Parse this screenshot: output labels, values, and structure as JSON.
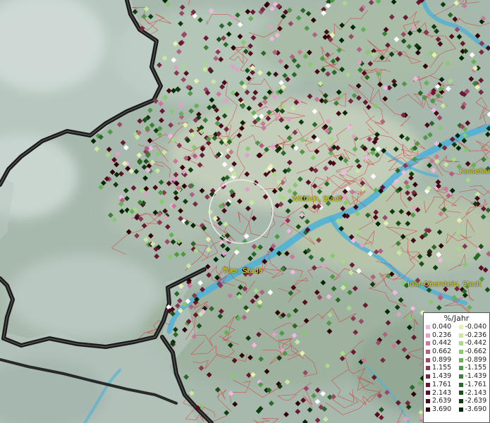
{
  "map": {
    "cities": [
      {
        "name": "Wittlich, Stadt"
      },
      {
        "name": "Trier, Stadt"
      },
      {
        "name": "Idar-Oberstein, Stadt"
      },
      {
        "name": "Kastellaun"
      }
    ]
  },
  "legend": {
    "title": "%/Jahr",
    "positive": [
      {
        "label": "0.040",
        "color": "#f0b8e0"
      },
      {
        "label": "0.236",
        "color": "#e0a0c8"
      },
      {
        "label": "0.442",
        "color": "#c87898"
      },
      {
        "label": "0.662",
        "color": "#b06080"
      },
      {
        "label": "0.899",
        "color": "#9a4868"
      },
      {
        "label": "1.155",
        "color": "#883850"
      },
      {
        "label": "1.439",
        "color": "#782840"
      },
      {
        "label": "1.761",
        "color": "#681830"
      },
      {
        "label": "2.143",
        "color": "#580c20"
      },
      {
        "label": "2.639",
        "color": "#480818"
      },
      {
        "label": "3.690",
        "color": "#300000"
      }
    ],
    "negative": [
      {
        "label": "-0.040",
        "color": "#e8f0b0"
      },
      {
        "label": "-0.236",
        "color": "#c8e8a0"
      },
      {
        "label": "-0.442",
        "color": "#a8d888"
      },
      {
        "label": "-0.662",
        "color": "#88c870"
      },
      {
        "label": "-0.899",
        "color": "#68b058"
      },
      {
        "label": "-1.155",
        "color": "#509848"
      },
      {
        "label": "-1.439",
        "color": "#3c8038"
      },
      {
        "label": "-1.761",
        "color": "#2a6828"
      },
      {
        "label": "-2.143",
        "color": "#1a5018"
      },
      {
        "label": "-2.639",
        "color": "#0e3c0e"
      },
      {
        "label": "-3.690",
        "color": "#002800"
      }
    ]
  }
}
